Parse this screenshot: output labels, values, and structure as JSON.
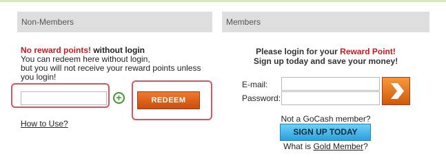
{
  "non_members": {
    "header": "Non-Members",
    "highlight": "No reward points!",
    "highlight_suffix": " without login",
    "lines": [
      "You can redeem here without login,",
      "but you will not receive your reward points unless",
      "you login!"
    ],
    "redeem_value": "",
    "redeem_button": "REDEEM",
    "how_to_use": "How to Use?"
  },
  "members": {
    "header": "Members",
    "prompt_prefix": "Please login for your ",
    "prompt_highlight": "Reward Point!",
    "subtitle": "Sign up today and save your money!",
    "email_label": "E-mail:",
    "password_label": "Password:",
    "email_value": "",
    "password_value": "",
    "not_member": "Not a GoCash member?",
    "signup_button": "SIGN UP TODAY",
    "gold_prefix": "What is ",
    "gold_link": "Gold Member",
    "gold_suffix": "?"
  },
  "colors": {
    "accent_red": "#c8171e",
    "outline_red": "#d9535d",
    "orange": "#e06318",
    "signup_blue": "#2aa1de",
    "plus_green": "#3a9a2a"
  },
  "icons": {
    "plus": "plus-circle-icon",
    "go": "chevron-right-icon"
  }
}
